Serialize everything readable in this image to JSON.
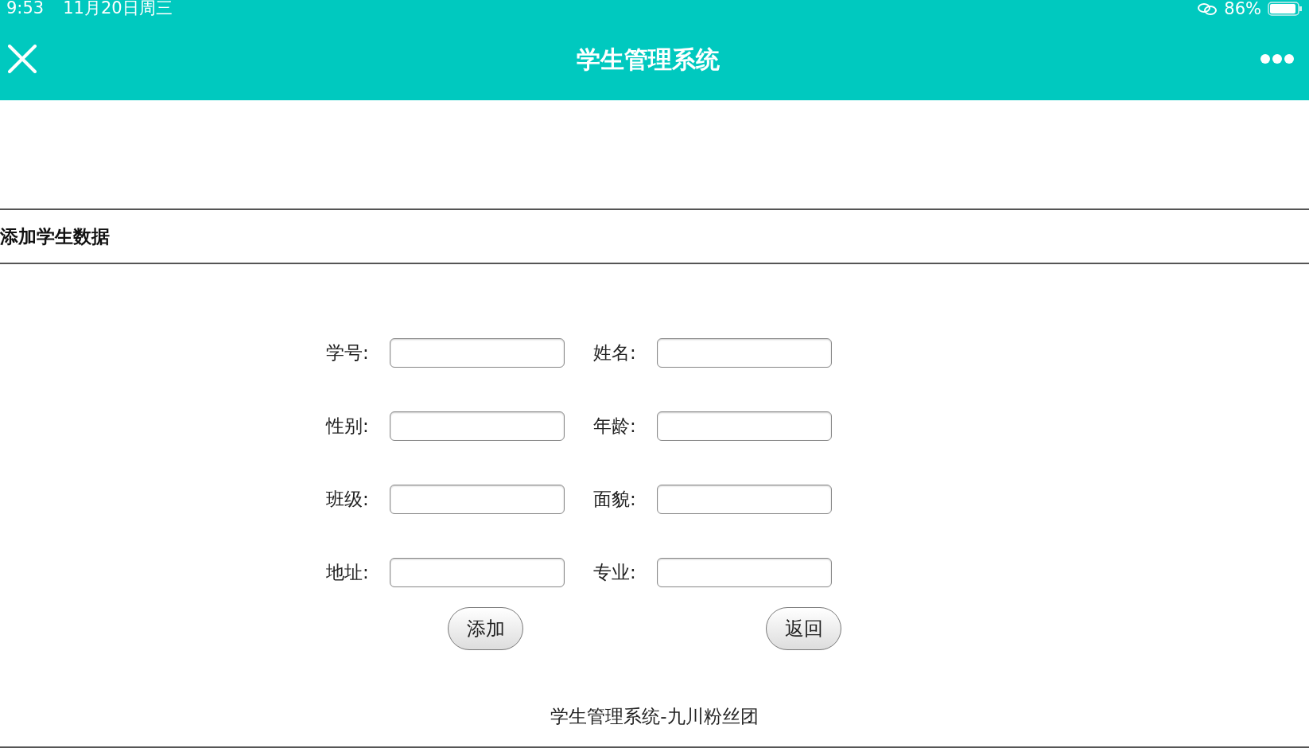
{
  "status_bar": {
    "time": "9:53",
    "date": "11月20日周三",
    "battery": "86%"
  },
  "nav_bar": {
    "title": "学生管理系统"
  },
  "section": {
    "title": "添加学生数据"
  },
  "fields": [
    {
      "label": "学号:"
    },
    {
      "label": "姓名:"
    },
    {
      "label": "性别:"
    },
    {
      "label": "年龄:"
    },
    {
      "label": "班级:"
    },
    {
      "label": "面貌:"
    },
    {
      "label": "地址:"
    },
    {
      "label": "专业:"
    }
  ],
  "buttons": [
    "添加",
    "返回"
  ],
  "footer": "学生管理系统-九川粉丝团"
}
